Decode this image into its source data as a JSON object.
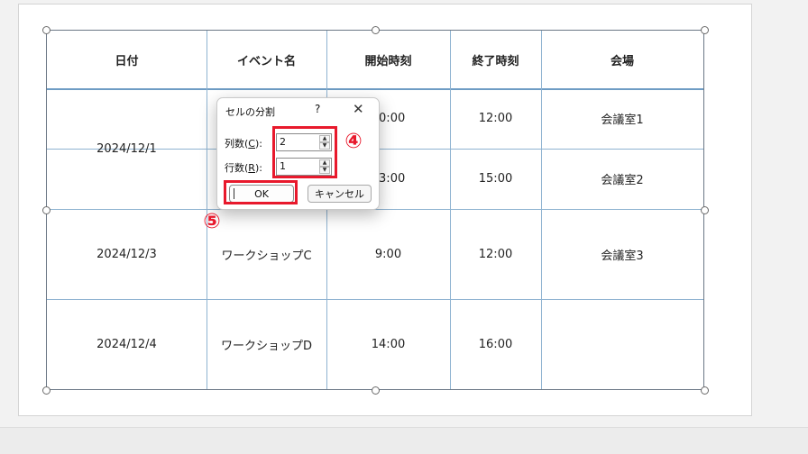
{
  "table": {
    "headers": [
      "日付",
      "イベント名",
      "開始時刻",
      "終了時刻",
      "会場"
    ],
    "rows": [
      {
        "date": "2024/12/1",
        "start1": "10:00",
        "end1": "12:00",
        "venue1": "会議室1",
        "start2": "13:00",
        "end2": "15:00",
        "venue2": "会議室2"
      },
      {
        "date": "2024/12/3",
        "event": "ワークショップC",
        "start": "9:00",
        "end": "12:00",
        "venue": "会議室3"
      },
      {
        "date": "2024/12/4",
        "event": "ワークショップD",
        "start": "14:00",
        "end": "16:00",
        "venue": ""
      }
    ]
  },
  "dialog": {
    "title": "セルの分割",
    "help": "?",
    "close": "✕",
    "columns_label_prefix": "列数(",
    "columns_label_key": "C",
    "columns_label_suffix": "):",
    "columns_value": "2",
    "rows_label_prefix": "行数(",
    "rows_label_key": "R",
    "rows_label_suffix": "):",
    "rows_value": "1",
    "ok_label": "OK",
    "cancel_label": "キャンセル",
    "up_arrow": "▲",
    "down_arrow": "▼"
  },
  "annotations": {
    "step4": "④",
    "step5": "⑤",
    "color": "#e8192c"
  }
}
